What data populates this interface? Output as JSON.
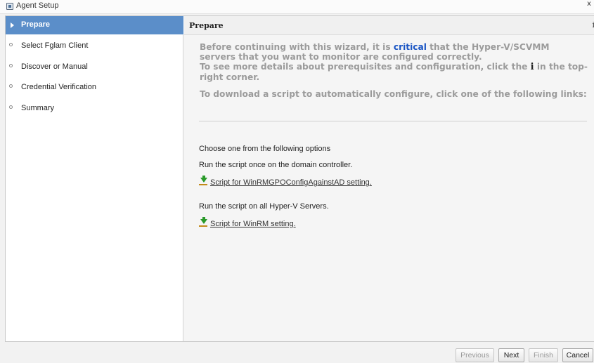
{
  "window": {
    "title": "Agent Setup",
    "close_glyph": "x"
  },
  "sidebar": {
    "items": [
      {
        "label": "Prepare",
        "active": true
      },
      {
        "label": "Select Fglam Client",
        "active": false
      },
      {
        "label": "Discover or Manual",
        "active": false
      },
      {
        "label": "Credential Verification",
        "active": false
      },
      {
        "label": "Summary",
        "active": false
      }
    ]
  },
  "content": {
    "title": "Prepare",
    "info_glyph": "i",
    "intro": {
      "before_critical": "Before continuing with this wizard, it is ",
      "critical": "critical",
      "after_critical": " that the Hyper-V/SCVMM servers that you want to monitor are configured correctly.",
      "details_before": "To see more details about prerequisites and configuration, click the ",
      "details_icon": "i",
      "details_after": " in the top-right corner.",
      "download": "To download a script to automatically configure, click one of the following links:"
    },
    "options_heading": "Choose one from the following options",
    "option1_text": "Run the script once on the domain controller.",
    "option1_link": "Script for WinRMGPOConfigAgainstAD setting.",
    "option2_text": "Run the script on all Hyper-V Servers.",
    "option2_link": "Script for WinRM setting."
  },
  "footer": {
    "previous": "Previous",
    "next": "Next",
    "finish": "Finish",
    "cancel": "Cancel"
  },
  "colors": {
    "accent": "#5b8ec9",
    "critical": "#1a55c4",
    "intro_text": "#9b9b9b"
  },
  "icons": {
    "window": "app-window-icon",
    "download": "download-arrow-icon",
    "info": "info-icon"
  }
}
